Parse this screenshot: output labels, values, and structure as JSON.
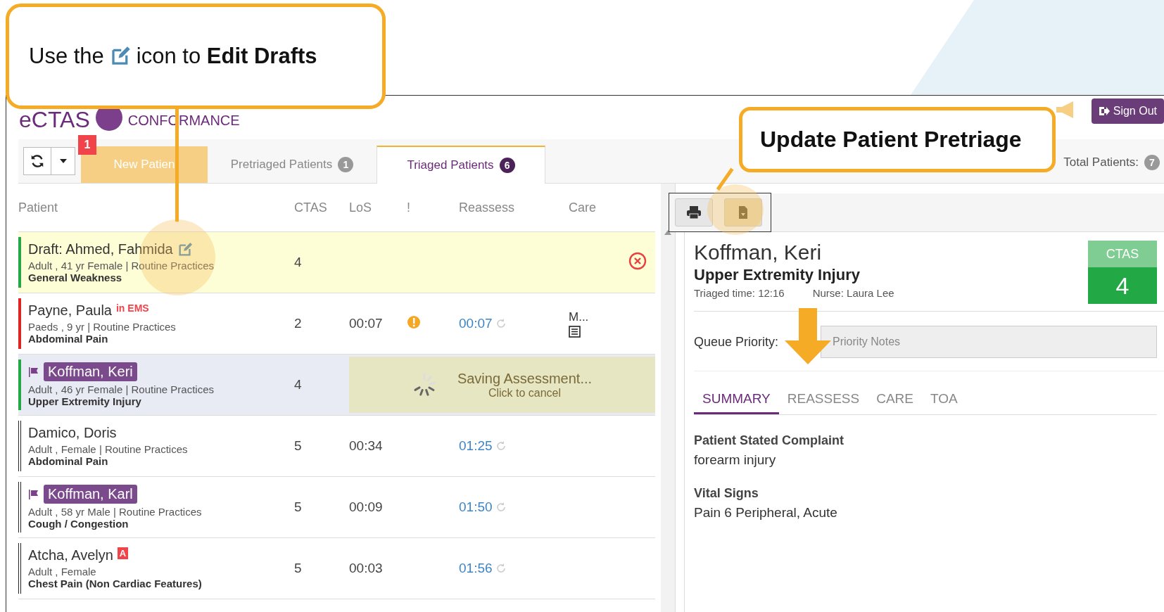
{
  "callouts": [
    {
      "kind": "edit",
      "before": "Use the",
      "after": "icon to **Edit Drafts**"
    },
    {
      "kind": "plain",
      "text": "Update Patient Pretriage"
    }
  ],
  "header": {
    "logo_text": "eCTAS",
    "logo_subtitle": "CONFORMANCE",
    "sign_out": "Sign Out"
  },
  "toolbar": {
    "notification_count": "1",
    "total_label": "Total Patients:",
    "total_count": "7"
  },
  "tabs": [
    {
      "label": "New Patien",
      "kind": "action",
      "selected": false
    },
    {
      "label": "Pretriaged Patients",
      "count": "1",
      "kind": "list",
      "selected": false
    },
    {
      "label": "Triaged Patients",
      "count": "6",
      "kind": "list",
      "selected": true
    }
  ],
  "table": {
    "columns": [
      "Patient",
      "CTAS",
      "LoS",
      "!",
      "Reassess",
      "Care"
    ],
    "rows": [
      {
        "kind": "draft",
        "name": "Draft: Ahmed, Fahmida",
        "flagged": false,
        "details": "Adult , 41 yr Female | Routine Practices",
        "complaint": "General Weakness",
        "ctas": "4",
        "color": "#22a845",
        "selected": false
      },
      {
        "kind": "patient",
        "name": "Payne, Paula",
        "tag": "in EMS",
        "flagged": false,
        "details": "Paeds , 9 yr | Routine Practices",
        "complaint": "Abdominal Pain",
        "ctas": "2",
        "los": "00:07",
        "alert": true,
        "reassess": "00:07",
        "care": "M...",
        "color": "#e02424",
        "selected": false
      },
      {
        "kind": "saving",
        "name": "Koffman, Keri",
        "flagged": true,
        "details": "Adult , 46 yr Female | Routine Practices",
        "complaint": "Upper Extremity Injury",
        "ctas": "4",
        "saving_title": "Saving Assessment...",
        "saving_subtitle": "Click to cancel",
        "color": "#22a845",
        "selected": true
      },
      {
        "kind": "patient",
        "name": "Damico, Doris",
        "flagged": false,
        "details": "Adult , Female | Routine Practices",
        "complaint": "Abdominal Pain",
        "ctas": "5",
        "los": "00:34",
        "alert": false,
        "reassess": "01:25",
        "color": "#222222",
        "selected": false
      },
      {
        "kind": "patient",
        "name": "Koffman, Karl",
        "flagged": true,
        "details": "Adult , 58 yr Male | Routine Practices",
        "complaint": "Cough / Congestion",
        "ctas": "5",
        "los": "00:09",
        "alert": false,
        "reassess": "01:50",
        "color": "#222222",
        "selected": false
      },
      {
        "kind": "patient",
        "name": "Atcha, Avelyn",
        "badge": "A",
        "flagged": false,
        "details": "Adult , Female",
        "complaint": "Chest Pain (Non Cardiac Features)",
        "ctas": "5",
        "los": "00:03",
        "alert": false,
        "reassess": "01:56",
        "color": "#222222",
        "selected": false
      }
    ]
  },
  "detail": {
    "name": "Koffman, Keri",
    "complaint": "Upper Extremity Injury",
    "triaged_time": "Triaged time: 12:16",
    "nurse": "Nurse: Laura Lee",
    "ctas_label": "CTAS",
    "ctas_value": "4",
    "queue_label": "Queue Priority:",
    "priority_placeholder": "Priority Notes",
    "tabs": [
      {
        "label": "SUMMARY",
        "selected": true
      },
      {
        "label": "REASSESS",
        "selected": false
      },
      {
        "label": "CARE",
        "selected": false
      },
      {
        "label": "TOA",
        "selected": false
      }
    ],
    "sections": [
      {
        "title": "Patient Stated Complaint",
        "value": "forearm injury"
      },
      {
        "title": "Vital Signs",
        "value": "Pain 6 Peripheral, Acute"
      }
    ]
  }
}
